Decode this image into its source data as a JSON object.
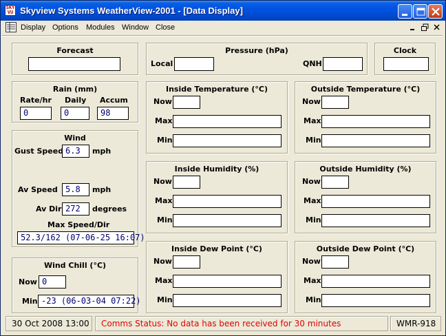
{
  "window": {
    "title": "Skyview Systems WeatherView-2001 - [Data Display]"
  },
  "menu": {
    "items": [
      "Display",
      "Options",
      "Modules",
      "Window",
      "Close"
    ]
  },
  "forecast": {
    "title": "Forecast",
    "value": ""
  },
  "pressure": {
    "title": "Pressure (hPa)",
    "local_label": "Local",
    "qnh_label": "QNH",
    "local": "",
    "qnh": ""
  },
  "clock": {
    "title": "Clock",
    "value": ""
  },
  "rain": {
    "title": "Rain (mm)",
    "rate_label": "Rate/hr",
    "daily_label": "Daily",
    "accum_label": "Accum",
    "rate": "0",
    "daily": "0",
    "accum": "98"
  },
  "wind": {
    "title": "Wind",
    "gust_label": "Gust Speed",
    "gust": "6.3",
    "gust_unit": "mph",
    "avspeed_label": "Av Speed",
    "avspeed": "5.8",
    "avspeed_unit": "mph",
    "avdir_label": "Av Dir",
    "avdir": "272",
    "avdir_unit": "degrees",
    "maxspeed_label": "Max Speed/Dir",
    "maxspeed": "52.3/162 (07-06-25 16:07)"
  },
  "windchill": {
    "title": "Wind Chill (°C)",
    "now_label": "Now",
    "now": "0",
    "min_label": "Min",
    "min": "-23 (06-03-04 07:22)"
  },
  "labels": {
    "now": "Now",
    "max": "Max",
    "min": "Min"
  },
  "panels": {
    "inside_temp": {
      "title": "Inside Temperature (°C)"
    },
    "outside_temp": {
      "title": "Outside Temperature (°C)"
    },
    "inside_hum": {
      "title": "Inside Humidity (%)"
    },
    "outside_hum": {
      "title": "Outside Humidity (%)"
    },
    "inside_dew": {
      "title": "Inside Dew Point (°C)"
    },
    "outside_dew": {
      "title": "Outside Dew Point (°C)"
    }
  },
  "status": {
    "datetime": "30 Oct 2008 13:00",
    "comms": "Comms Status: No data has been received for 30 minutes",
    "comms_color": "#e00000",
    "model": "WMR-918"
  },
  "colors": {
    "titlebar": "#0054e3",
    "window_bg": "#ece9d8",
    "value_text": "#00006e"
  }
}
